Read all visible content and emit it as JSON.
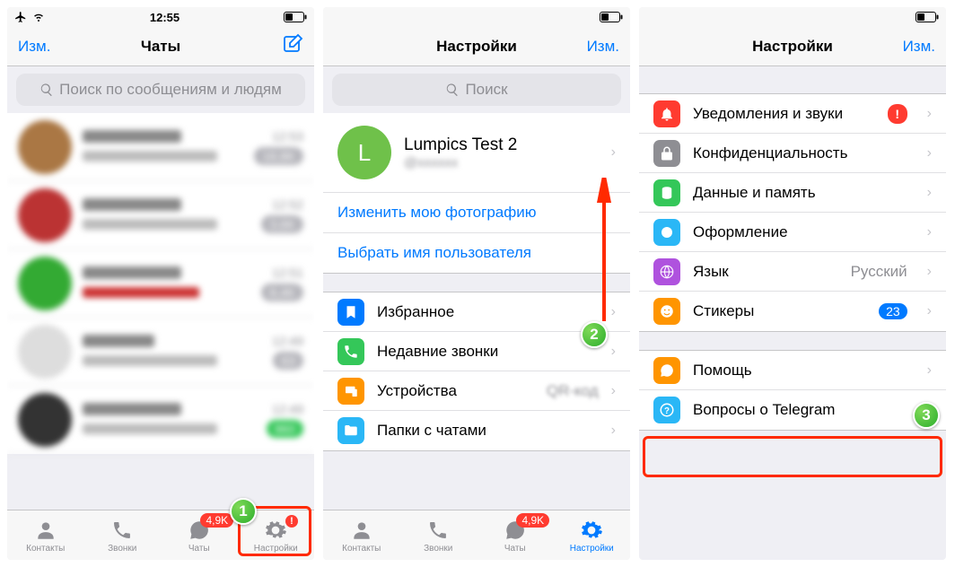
{
  "status": {
    "time": "12:55"
  },
  "colors": {
    "link": "#007aff",
    "red": "#ff3b30",
    "green": "#34c759",
    "gray": "#8e8e93"
  },
  "steps": {
    "s1": "1",
    "s2": "2",
    "s3": "3"
  },
  "screen1": {
    "nav": {
      "left": "Изм.",
      "title": "Чаты"
    },
    "search": "Поиск по сообщениям и людям",
    "chats": [
      {
        "time": "12:53",
        "badge": "18,8K"
      },
      {
        "time": "12:52",
        "badge": "3,6K"
      },
      {
        "time": "12:51",
        "badge": "8,4K"
      },
      {
        "time": "12:49",
        "badge": "63"
      },
      {
        "time": "12:49",
        "badge": "960"
      }
    ],
    "tabs": {
      "contacts": "Контакты",
      "calls": "Звонки",
      "chats": "Чаты",
      "settings": "Настройки",
      "chats_badge": "4,9K",
      "settings_badge": "!"
    }
  },
  "screen2": {
    "nav": {
      "title": "Настройки",
      "right": "Изм."
    },
    "search": "Поиск",
    "profile": {
      "name": "Lumpics Test 2",
      "initial": "L"
    },
    "links": {
      "photo": "Изменить мою фотографию",
      "username": "Выбрать имя пользователя"
    },
    "items": [
      {
        "key": "fav",
        "label": "Избранное",
        "color": "#007aff"
      },
      {
        "key": "recent",
        "label": "Недавние звонки",
        "color": "#34c759"
      },
      {
        "key": "devices",
        "label": "Устройства",
        "value": "QR-код",
        "color": "#ff9500"
      },
      {
        "key": "folders",
        "label": "Папки с чатами",
        "color": "#2ab7f6"
      }
    ],
    "tabs": {
      "contacts": "Контакты",
      "calls": "Звонки",
      "chats": "Чаты",
      "settings": "Настройки",
      "chats_badge": "4,9K"
    }
  },
  "screen3": {
    "nav": {
      "title": "Настройки",
      "right": "Изм."
    },
    "groupA": [
      {
        "key": "notif",
        "label": "Уведомления и звуки",
        "color": "#ff3b30",
        "alert": "!"
      },
      {
        "key": "priv",
        "label": "Конфиденциальность",
        "color": "#8e8e93"
      },
      {
        "key": "data",
        "label": "Данные и память",
        "color": "#34c759"
      },
      {
        "key": "theme",
        "label": "Оформление",
        "color": "#2ab7f6"
      },
      {
        "key": "lang",
        "label": "Язык",
        "value": "Русский",
        "color": "#af52de"
      },
      {
        "key": "stickers",
        "label": "Стикеры",
        "badge": "23",
        "color": "#ff9500"
      }
    ],
    "groupB": [
      {
        "key": "help",
        "label": "Помощь",
        "color": "#ff9500"
      },
      {
        "key": "faq",
        "label": "Вопросы о Telegram",
        "color": "#2ab7f6"
      }
    ]
  }
}
